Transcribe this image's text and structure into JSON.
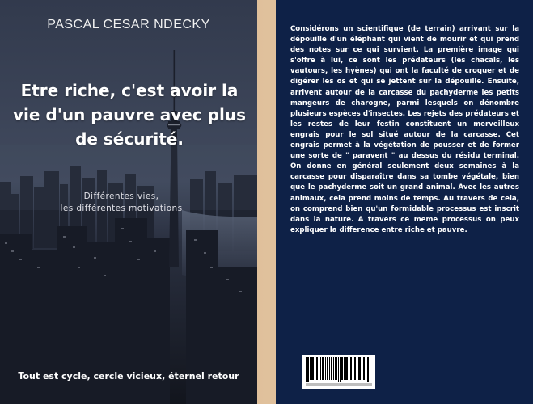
{
  "front_cover": {
    "author": "PASCAL CESAR NDECKY",
    "title": "Etre riche, c'est avoir la vie d'un pauvre avec plus de sécurité.",
    "subtitle_lines": [
      "Différentes vies,",
      "les différentes motivations"
    ],
    "tagline": "Tout est cycle, cercle vicieux, éternel retour",
    "background_image": "night-city-skyline-with-tower"
  },
  "back_cover": {
    "blurb": "Considérons un scientifique (de terrain) arrivant sur la dépouille d'un éléphant qui vient de mourir et qui prend des notes sur ce qui survient. La première image qui s'offre à lui, ce sont les prédateurs (les chacals, les vautours, les hyènes) qui ont la faculté de croquer et de digérer les os et qui se jettent sur la dépouille. Ensuite, arrivent autour de la carcasse du pachyderme les petits mangeurs de charogne, parmi lesquels on dénombre plusieurs espèces d'insectes. Les rejets des prédateurs et les restes de leur festin constituent un merveilleux engrais pour le sol situé autour de la carcasse. Cet engrais permet à la végétation de pousser et de former une sorte de \" paravent \" au dessus du résidu terminal. On donne en général seulement deux semaines à la carcasse pour disparaître dans sa tombe végétale, bien que le pachyderme soit un grand animal. Avec les autres animaux, cela prend moins de temps. Au travers de cela, on comprend bien qu'un formidable processus est inscrit dans la nature. A travers ce meme processus on peux expliquer la difference entre riche et pauvre.",
    "barcode": "isbn-barcode"
  },
  "colors": {
    "back_cover_bg": "#0e2147",
    "spine_bg": "#d9b68c",
    "front_text": "#ffffff"
  }
}
